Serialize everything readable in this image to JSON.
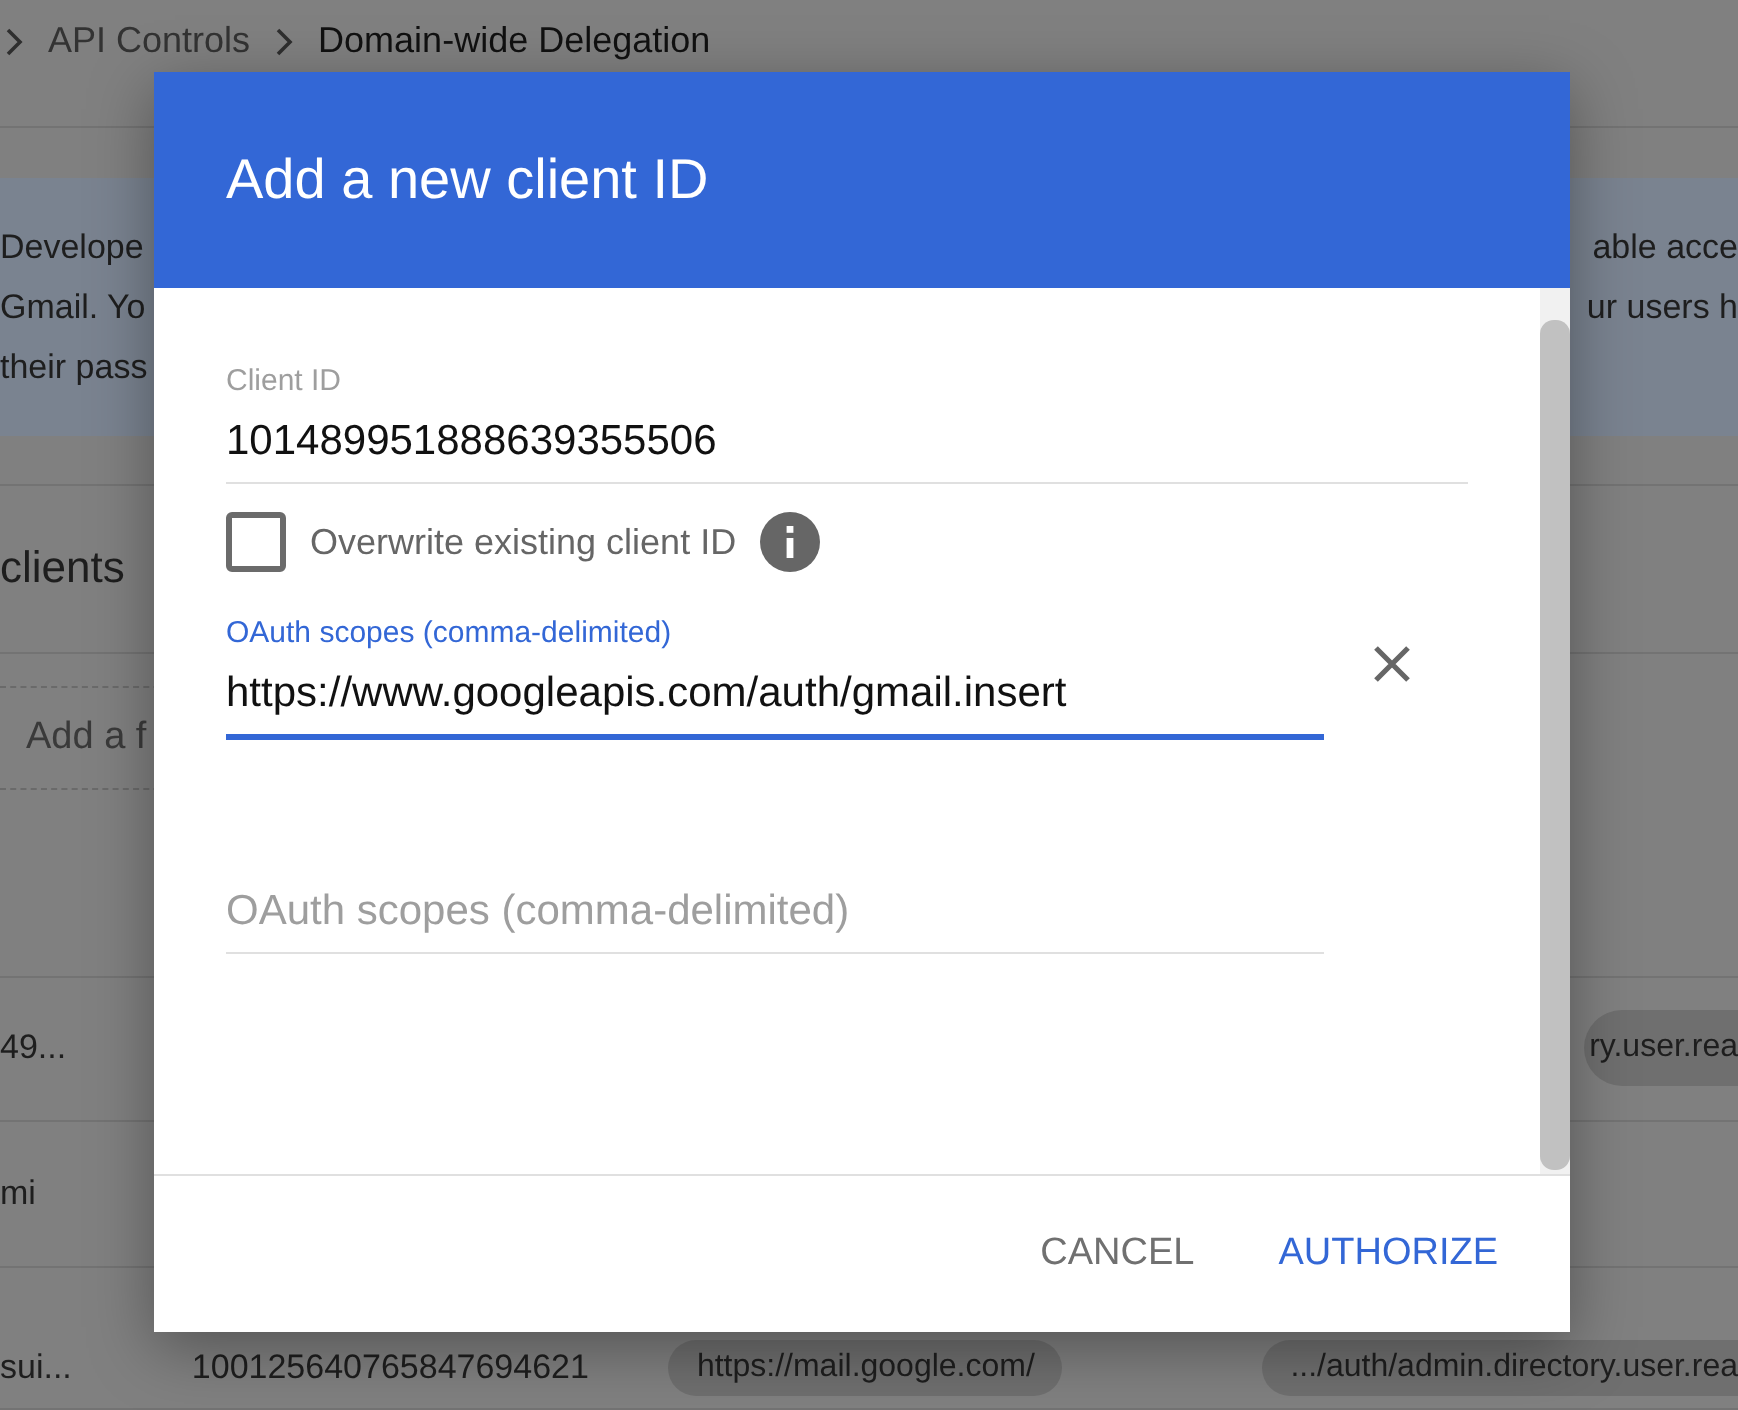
{
  "breadcrumb": [
    {
      "label": "API Controls"
    },
    {
      "label": "Domain-wide Delegation"
    }
  ],
  "banner": {
    "left_lines": [
      "Develope",
      "Gmail. Yo",
      "their pass"
    ],
    "right_lines": [
      "able acce",
      "ur users h"
    ]
  },
  "section_title": "clients",
  "filter": {
    "placeholder": "Add a f"
  },
  "rows": [
    {
      "name": "49...",
      "scope_chip": "ry.user.rea"
    },
    {
      "name": "mi"
    },
    {
      "name": "sui...",
      "client_id": "100125640765847694621",
      "chip": "https://mail.google.com/",
      "scope_chip": ".../auth/admin.directory.user.rea"
    }
  ],
  "dialog": {
    "title": "Add a new client ID",
    "client_id": {
      "label": "Client ID",
      "value": "101489951888639355506"
    },
    "overwrite": {
      "label": "Overwrite existing client ID",
      "checked": false
    },
    "scopes": [
      {
        "label": "OAuth scopes (comma-delimited)",
        "value": "https://www.googleapis.com/auth/gmail.insert",
        "focused": true
      },
      {
        "placeholder": "OAuth scopes (comma-delimited)",
        "focused": false
      }
    ],
    "buttons": [
      {
        "label": "CANCEL",
        "kind": "secondary"
      },
      {
        "label": "AUTHORIZE",
        "kind": "primary"
      }
    ]
  }
}
